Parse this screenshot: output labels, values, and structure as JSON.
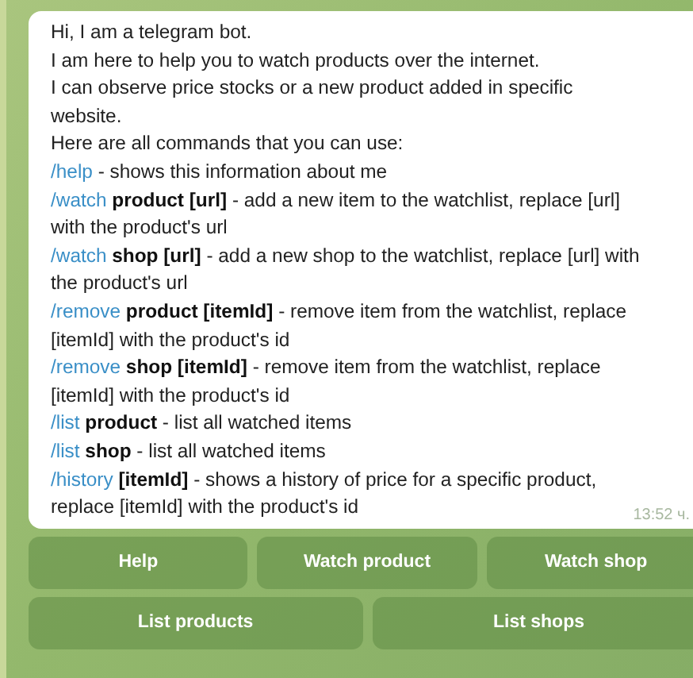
{
  "message": {
    "intro": [
      "Hi, I am a telegram bot.",
      "I am here to help you to watch products over the internet.",
      "I can observe price stocks or a new product added in specific website.",
      "Here are all commands that you can use:"
    ],
    "commands": [
      {
        "command": "/help",
        "text": "- shows this information about me"
      },
      {
        "command": "/watch",
        "text": "**product [url]** - add a new item to the watchlist, replace [url] with the product's url"
      },
      {
        "command": "/watch",
        "text": "**shop [url]** - add a new shop to the watchlist, replace [url] with the product's url"
      },
      {
        "command": "/remove",
        "text": "**product [itemId]** - remove item from the watchlist, replace [itemId] with the product's id"
      },
      {
        "command": "/remove",
        "text": "**shop [itemId]** - remove item from the watchlist, replace [itemId] with the product's id"
      },
      {
        "command": "/list",
        "text": "**product** - list all watched items"
      },
      {
        "command": "/list",
        "text": "**shop** - list all watched items"
      },
      {
        "command": "/history",
        "text": "**[itemId]** - shows a history of price for a specific product, replace [itemId] with the product's id"
      }
    ],
    "time": "13:52 ч."
  },
  "keyboard": [
    [
      "Help",
      "Watch product",
      "Watch shop"
    ],
    [
      "List products",
      "List shops"
    ]
  ]
}
